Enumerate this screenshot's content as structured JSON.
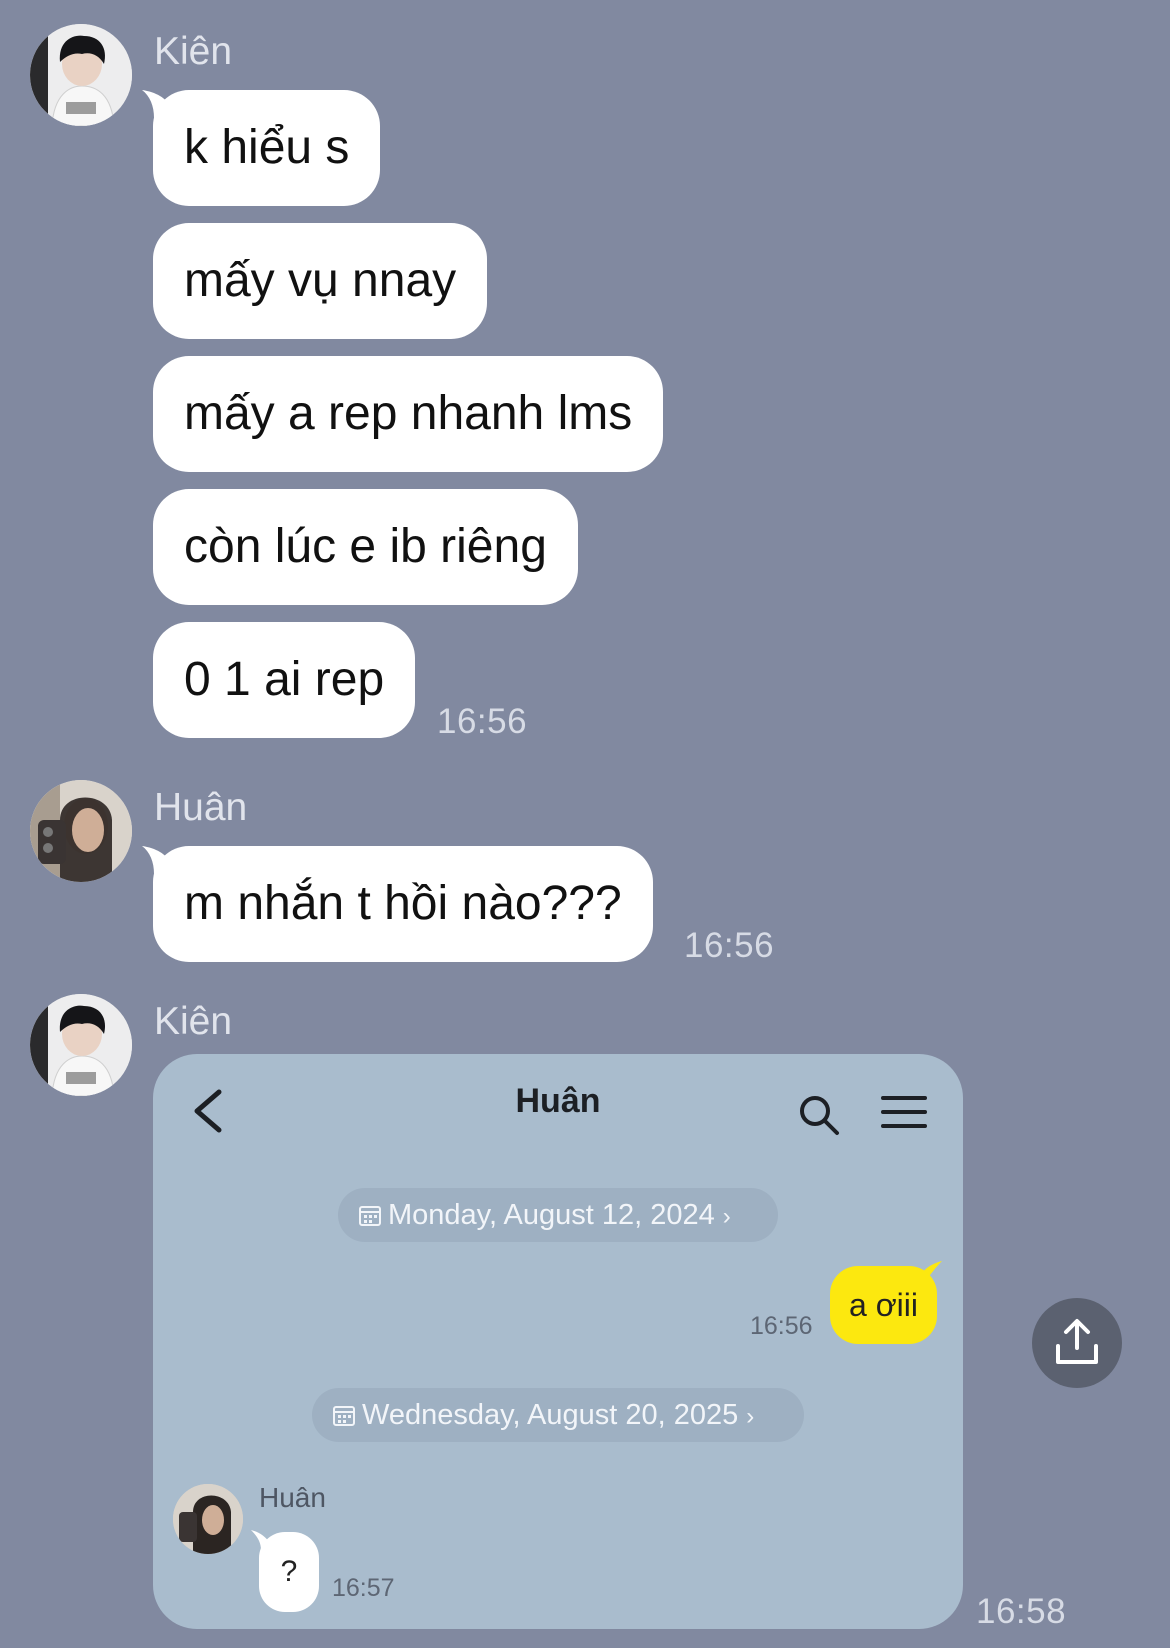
{
  "messages": [
    {
      "sender": "Kiên",
      "lines": [
        "k hiểu s",
        "mấy vụ nnay",
        "mấy a rep nhanh lms",
        "còn lúc e ib riêng",
        "0 1 ai rep"
      ],
      "time": "16:56"
    },
    {
      "sender": "Huân",
      "lines": [
        "m nhắn t hồi nào???"
      ],
      "time": "16:56"
    },
    {
      "sender": "Kiên",
      "time": "16:58"
    }
  ],
  "shared_screenshot": {
    "header": {
      "title": "Huân"
    },
    "date_1": "Monday, August 12, 2024",
    "date_2": "Wednesday, August 20, 2025",
    "outgoing": {
      "text": "a ơiii",
      "time": "16:56"
    },
    "incoming": {
      "sender": "Huân",
      "text": "?",
      "time": "16:57"
    }
  },
  "icons": {
    "back": "chevron-left-icon",
    "search": "search-icon",
    "menu": "hamburger-menu-icon",
    "share": "share-upload-icon",
    "calendar": "calendar-icon"
  },
  "colors": {
    "background": "#8189a0",
    "bubble": "#ffffff",
    "card": "#a9bccd",
    "outgoing_bubble": "#fce80f"
  }
}
